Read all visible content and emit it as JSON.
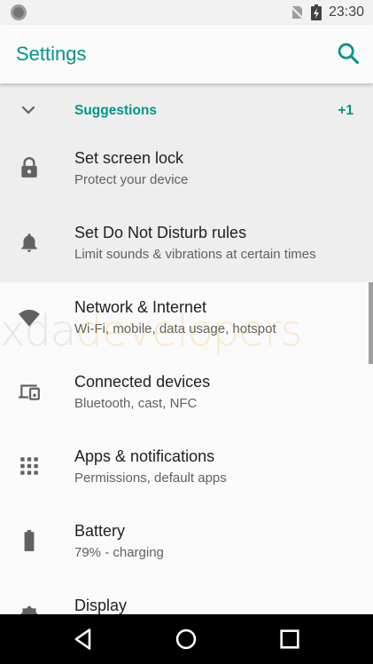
{
  "status_bar": {
    "time": "23:30"
  },
  "app_bar": {
    "title": "Settings",
    "search_icon": "search-icon"
  },
  "suggestions": {
    "label": "Suggestions",
    "count": "+1",
    "items": [
      {
        "title": "Set screen lock",
        "subtitle": "Protect your device",
        "icon": "lock-icon"
      },
      {
        "title": "Set Do Not Disturb rules",
        "subtitle": "Limit sounds & vibrations at certain times",
        "icon": "bell-icon"
      }
    ]
  },
  "settings": [
    {
      "title": "Network & Internet",
      "subtitle": "Wi-Fi, mobile, data usage, hotspot",
      "icon": "wifi-icon"
    },
    {
      "title": "Connected devices",
      "subtitle": "Bluetooth, cast, NFC",
      "icon": "devices-icon"
    },
    {
      "title": "Apps & notifications",
      "subtitle": "Permissions, default apps",
      "icon": "apps-grid-icon"
    },
    {
      "title": "Battery",
      "subtitle": "79% - charging",
      "icon": "battery-icon"
    },
    {
      "title": "Display",
      "subtitle": "",
      "icon": "display-icon"
    }
  ],
  "watermark": {
    "part1": "xda",
    "part2": "developers"
  },
  "colors": {
    "accent": "#009688",
    "nav_bar": "#000000",
    "suggestions_bg": "#eeeeee"
  }
}
